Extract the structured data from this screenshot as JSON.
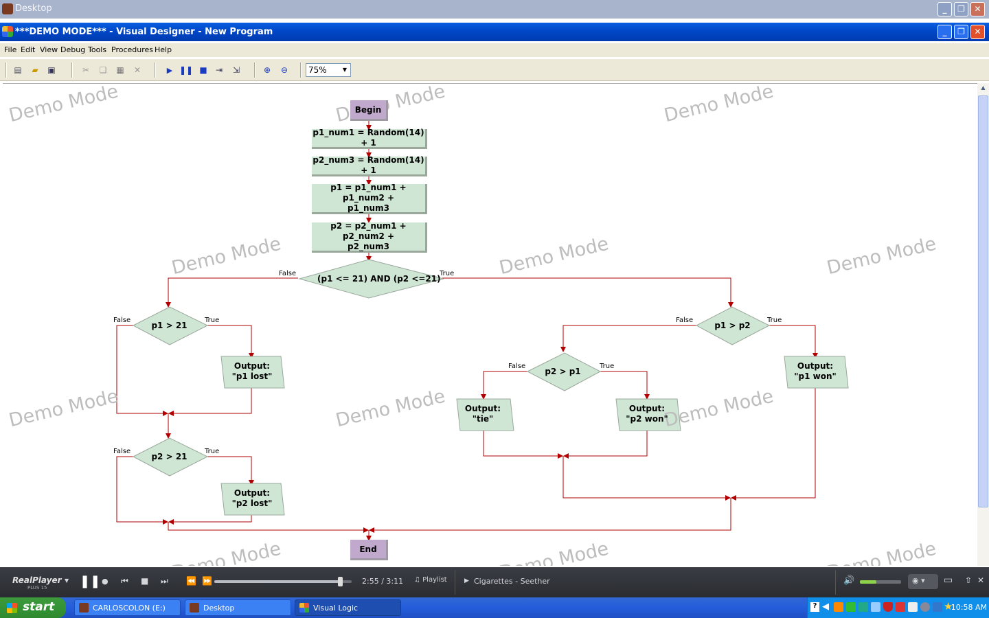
{
  "desktop": {
    "title": "Desktop"
  },
  "window": {
    "title": "***DEMO MODE*** - Visual Designer - New Program"
  },
  "menu": [
    "File",
    "Edit",
    "View",
    "Debug",
    "Tools",
    "Procedures",
    "Help"
  ],
  "toolbar": {
    "zoom_value": "75%"
  },
  "watermark": "Demo Mode",
  "flow": {
    "begin": "Begin",
    "end": "End",
    "s1": "p1_num1 = Random(14) + 1",
    "s2": "p2_num3 = Random(14) + 1",
    "s3a": "p1 = p1_num1 + p1_num2 +",
    "s3b": "p1_num3",
    "s4a": "p2 = p2_num1 + p2_num2 +",
    "s4b": "p2_num3",
    "d_main": "(p1  <= 21) AND (p2 <=21)",
    "d_p1_21": "p1 > 21",
    "d_p2_21": "p2 > 21",
    "d_p1p2": "p1 > p2",
    "d_p2p1": "p2 > p1",
    "o_p1lost_a": "Output:",
    "o_p1lost_b": "\"p1 lost\"",
    "o_p2lost_a": "Output:",
    "o_p2lost_b": "\"p2 lost\"",
    "o_tie_a": "Output:",
    "o_tie_b": "\"tie\"",
    "o_p2won_a": "Output:",
    "o_p2won_b": "\"p2 won\"",
    "o_p1won_a": "Output:",
    "o_p1won_b": "\"p1 won\"",
    "true_label": "True",
    "false_label": "False"
  },
  "player": {
    "brand": "RealPlayer",
    "brand_sub": "PLUS 15",
    "time": "2:55 / 3:11",
    "progress": 0.92,
    "playlist_label": "Playlist",
    "track": "Cigarettes - Seether"
  },
  "taskbar": {
    "start": "start",
    "tasks": [
      "CARLOSCOLON (E:)",
      "Desktop",
      "Visual Logic"
    ],
    "clock": "10:58 AM"
  },
  "colors": {
    "title_blue": "#0047c8",
    "process_fill": "#cfe6d4",
    "terminal_fill": "#c0a9cc",
    "connector": "#b20000"
  }
}
